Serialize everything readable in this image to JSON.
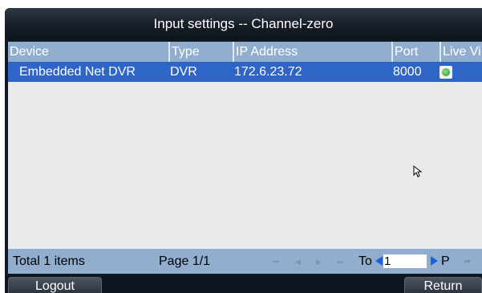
{
  "dialog": {
    "title": "Input settings -- Channel-zero"
  },
  "table": {
    "columns": [
      "Device",
      "Type",
      "IP Address",
      "Port",
      "Live Vi"
    ],
    "rows": [
      {
        "device": "Embedded Net DVR",
        "type": "DVR",
        "ip": "172.6.23.72",
        "port": "8000",
        "live_view": "live-view-icon"
      }
    ]
  },
  "pagination": {
    "total": "Total 1 items",
    "page": "Page 1/1",
    "first": "⏮",
    "prev": "◀",
    "next": "▶",
    "last": "⏭",
    "to_label": "To",
    "page_input": "1",
    "p_label": "P",
    "go": "➡"
  },
  "buttons": {
    "logout": "Logout",
    "return": "Return"
  },
  "colors": {
    "header_bg": "#92aecf",
    "selected_row": "#2e65c7",
    "title_bg": "#161d27"
  }
}
